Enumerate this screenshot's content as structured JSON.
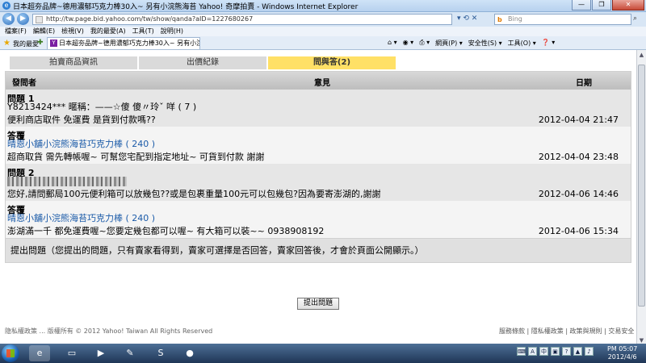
{
  "browser": {
    "window_title": "日本超夯品牌~德用濃郁巧克力棒30入~ 另有小浣熊海苔 Yahoo! 奇摩拍賣 - Windows Internet Explorer",
    "url": "http://tw.page.bid.yahoo.com/tw/show/qanda?aID=1227680267",
    "search_placeholder": "Bing",
    "menu": [
      "檔案(F)",
      "編輯(E)",
      "檢視(V)",
      "我的最愛(A)",
      "工具(T)",
      "說明(H)"
    ],
    "favorites_label": "我的最愛",
    "tab_title": "日本超夯品牌~德用濃郁巧克力棒30入~ 另有小浣...",
    "commands": [
      "網頁(P) ▾",
      "安全性(S) ▾",
      "工具(O) ▾",
      "❓ ▾"
    ]
  },
  "page": {
    "tabs": [
      "拍賣商品資訊",
      "出價紀錄",
      "問與答(2)"
    ],
    "table_headers": {
      "asker": "發問者",
      "opinion": "意見",
      "date": "日期"
    },
    "entries": [
      {
        "question_label": "問題 1",
        "asker": "Y8213424*** 暱稱：——☆傻 傻〃玲ˇ 咩 ( 7 )",
        "question": "便利商店取件 免運費 是貨到付款嗎??",
        "question_date": "2012-04-04 21:47",
        "answer_label": "答覆",
        "seller": "晴恩小舖小浣熊海苔巧克力棒 ( 240 )",
        "answer": "超商取貨 需先轉帳喔~ 可幫您宅配到指定地址~ 可貨到付款 謝謝",
        "answer_date": "2012-04-04 23:48"
      },
      {
        "question_label": "問題 2",
        "asker": "",
        "question": "您好,請問郵局100元便利箱可以放幾包??或是包裹重量100元可以包幾包?因為要寄澎湖的,謝謝",
        "question_date": "2012-04-06 14:46",
        "answer_label": "答覆",
        "seller": "晴恩小舖小浣熊海苔巧克力棒 ( 240 )",
        "answer": "澎湖滿一千 都免運費喔~您要定幾包都可以喔~ 有大箱可以裝~~ 0938908192",
        "answer_date": "2012-04-06 15:34"
      }
    ],
    "submit_note": "提出問題（您提出的問題，只有賣家看得到，賣家可選擇是否回答，賣家回答後，才會於頁面公開顯示。）",
    "submit_button": "提出問題",
    "footer_left": "隐私權政策 ... 版權所有 © 2012 Yahoo! Taiwan All Rights Reserved",
    "footer_right": "服務條款 | 隱私權政策 | 政策與規則 | 交易安全"
  },
  "taskbar": {
    "clock_time": "PM 05:07",
    "clock_date": "2012/4/6"
  }
}
